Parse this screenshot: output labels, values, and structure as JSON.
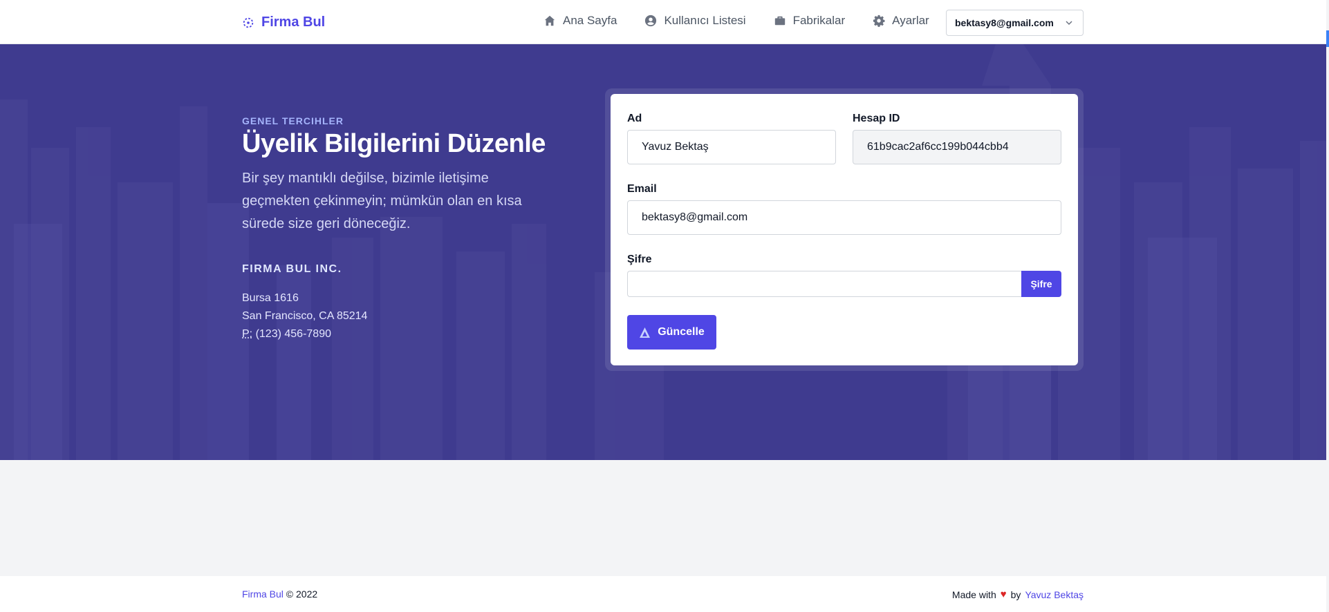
{
  "navbar": {
    "brand": "Firma Bul",
    "items": [
      {
        "label": "Ana Sayfa",
        "icon": "home-icon"
      },
      {
        "label": "Kullanıcı Listesi",
        "icon": "user-circle-icon"
      },
      {
        "label": "Fabrikalar",
        "icon": "briefcase-icon"
      },
      {
        "label": "Ayarlar",
        "icon": "gear-icon"
      }
    ],
    "user_email": "bektasy8@gmail.com"
  },
  "hero": {
    "eyebrow": "GENEL TERCIHLER",
    "title": "Üyelik Bilgilerini Düzenle",
    "lead": "Bir şey mantıklı değilse, bizimle iletişime geçmekten çekinmeyin; mümkün olan en kısa sürede size geri döneceğiz.",
    "company": "FIRMA BUL INC.",
    "address_line1": "Bursa 1616",
    "address_line2": "San Francisco, CA 85214",
    "phone_prefix": "P:",
    "phone": "(123) 456-7890"
  },
  "form": {
    "name_label": "Ad",
    "name_value": "Yavuz Bektaş",
    "account_label": "Hesap ID",
    "account_value": "61b9cac2af6cc199b044cbb4",
    "email_label": "Email",
    "email_value": "bektasy8@gmail.com",
    "password_label": "Şifre",
    "password_value": "",
    "password_button": "Şifre",
    "save_button": "Güncelle"
  },
  "footer": {
    "brand_link": "Firma Bul",
    "copyright": "© 2022",
    "made_with": "Made with",
    "by": "by",
    "author": "Yavuz Bektaş"
  },
  "colors": {
    "accent": "#4f46e5",
    "hero_bg": "#3f3b8f",
    "heart": "#dc2626"
  }
}
